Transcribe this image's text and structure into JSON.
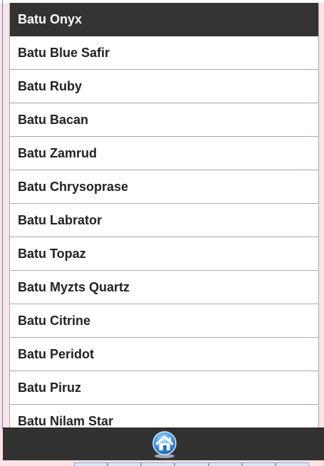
{
  "list": {
    "items": [
      {
        "label": "Batu Onyx",
        "selected": true
      },
      {
        "label": "Batu Blue Safir"
      },
      {
        "label": "Batu Ruby"
      },
      {
        "label": "Batu Bacan"
      },
      {
        "label": "Batu Zamrud"
      },
      {
        "label": "Batu Chrysoprase"
      },
      {
        "label": "Batu Labrator"
      },
      {
        "label": "Batu Topaz"
      },
      {
        "label": "Batu Myzts Quartz"
      },
      {
        "label": "Batu Citrine"
      },
      {
        "label": "Batu Peridot"
      },
      {
        "label": "Batu Piruz"
      },
      {
        "label": "Batu Nilam Star"
      }
    ]
  },
  "bottom_bar": {
    "home_icon": "home-icon"
  },
  "colors": {
    "selected_bg": "#333333",
    "bar_bg": "#323232",
    "frame_bg": "#fde2e6",
    "home_blue": "#2f8fe0"
  }
}
